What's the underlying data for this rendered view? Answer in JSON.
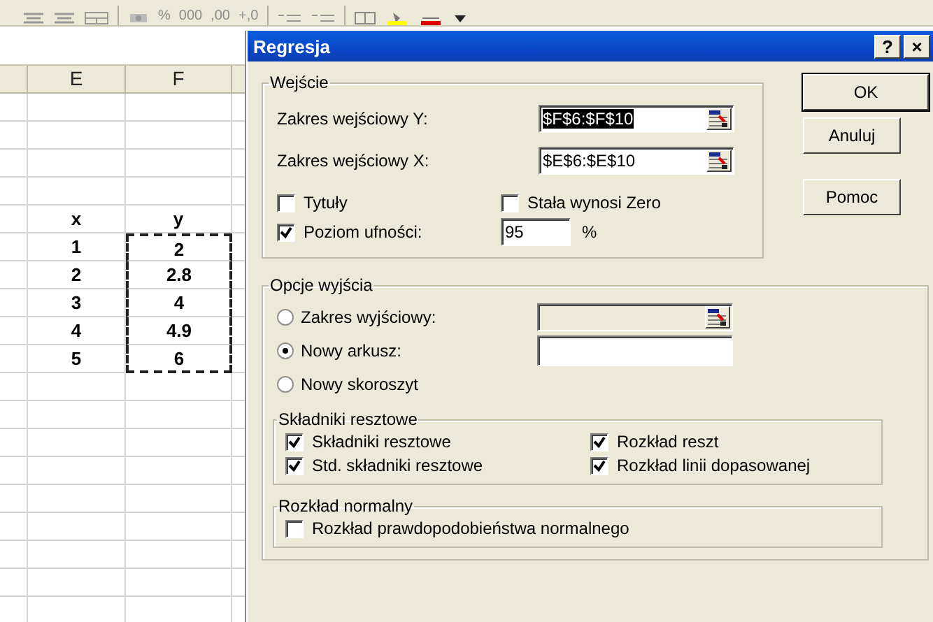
{
  "toolbar": [
    {
      "kind": "align"
    },
    {
      "kind": "align"
    },
    {
      "kind": "merge"
    },
    {
      "kind": "separator"
    },
    {
      "kind": "currency"
    },
    {
      "kind": "text",
      "label": "%"
    },
    {
      "kind": "text",
      "label": "000"
    },
    {
      "kind": "text",
      "label": ",00"
    },
    {
      "kind": "text",
      "label": "+,0"
    },
    {
      "kind": "separator"
    },
    {
      "kind": "indent"
    },
    {
      "kind": "indent"
    },
    {
      "kind": "separator"
    },
    {
      "kind": "border"
    },
    {
      "kind": "fill"
    },
    {
      "kind": "fontcolor"
    },
    {
      "kind": "dropdown"
    }
  ],
  "sheet": {
    "columns": [
      "E",
      "F"
    ],
    "rows": [
      {
        "cells": [
          {
            "text": "x",
            "marked": false
          },
          {
            "text": "y",
            "marked": false
          }
        ]
      },
      {
        "cells": [
          {
            "text": "1",
            "marked": false
          },
          {
            "text": "2",
            "marked": true
          }
        ]
      },
      {
        "cells": [
          {
            "text": "2",
            "marked": false
          },
          {
            "text": "2.8",
            "marked": true
          }
        ]
      },
      {
        "cells": [
          {
            "text": "3",
            "marked": false
          },
          {
            "text": "4",
            "marked": true
          }
        ]
      },
      {
        "cells": [
          {
            "text": "4",
            "marked": false
          },
          {
            "text": "4.9",
            "marked": true
          }
        ]
      },
      {
        "cells": [
          {
            "text": "5",
            "marked": false
          },
          {
            "text": "6",
            "marked": true
          }
        ]
      }
    ]
  },
  "dialog": {
    "title": "Regresja",
    "title_buttons": [
      "?",
      "×"
    ],
    "input_group": {
      "title": "Wejście",
      "ranges": [
        {
          "label": "Zakres wejściowy Y:",
          "value": "$F$6:$F$10",
          "selected": true
        },
        {
          "label": "Zakres wejściowy X:",
          "value": "$E$6:$E$10",
          "selected": false
        }
      ],
      "options": [
        {
          "label": "Tytuły",
          "checked": false
        },
        {
          "label": "Stała wynosi Zero",
          "checked": false
        },
        {
          "label": "Poziom ufności:",
          "checked": true
        }
      ],
      "confidence": {
        "value": "95",
        "unit": "%"
      }
    },
    "buttons": [
      "OK",
      "Anuluj",
      "Pomoc"
    ],
    "output_group": {
      "title": "Opcje wyjścia",
      "destinations": [
        {
          "label": "Zakres wyjściowy:",
          "selected": false,
          "field": {
            "disabled": true
          }
        },
        {
          "label": "Nowy arkusz:",
          "selected": true,
          "field": {
            "disabled": false
          }
        },
        {
          "label": "Nowy skoroszyt",
          "selected": false
        }
      ],
      "residuals": {
        "title": "Składniki resztowe",
        "options": [
          {
            "label": "Składniki resztowe",
            "checked": true
          },
          {
            "label": "Rozkład reszt",
            "checked": true
          },
          {
            "label": "Std. składniki resztowe",
            "checked": true
          },
          {
            "label": "Rozkład linii dopasowanej",
            "checked": true
          }
        ]
      },
      "normal": {
        "title": "Rozkład normalny",
        "options": [
          {
            "label": "Rozkład prawdopodobieństwa normalnego",
            "checked": false
          }
        ]
      }
    }
  }
}
